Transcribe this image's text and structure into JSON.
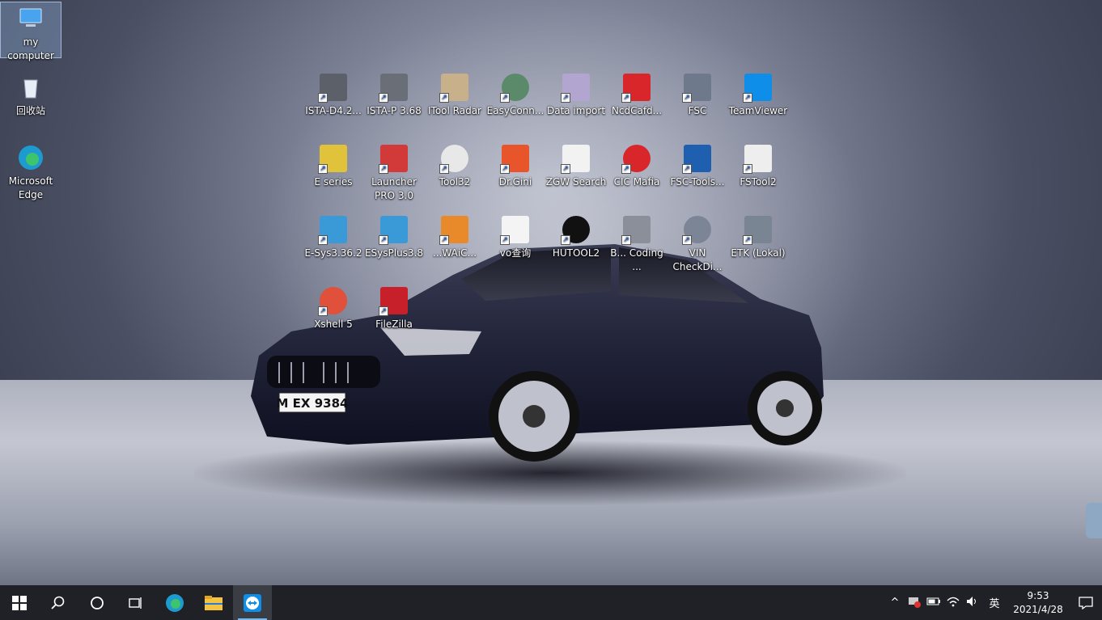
{
  "desktop_icons": [
    {
      "label": "my computer",
      "icon": "computer-icon"
    },
    {
      "label": "回收站",
      "icon": "recycle-bin-icon"
    },
    {
      "label": "Microsoft Edge",
      "icon": "edge-icon"
    }
  ],
  "shortcuts": [
    {
      "label": "ISTA-D4.2...",
      "icon": "ista-d-icon"
    },
    {
      "label": "ISTA-P 3.68",
      "icon": "ista-p-icon"
    },
    {
      "label": "ITool Radar",
      "icon": "itool-radar-icon"
    },
    {
      "label": "EasyConn...",
      "icon": "easyconnect-icon"
    },
    {
      "label": "Data import",
      "icon": "data-import-icon"
    },
    {
      "label": "NcdCafd...",
      "icon": "ncdcafd-icon"
    },
    {
      "label": "FSC",
      "icon": "fsc-icon"
    },
    {
      "label": "TeamViewer",
      "icon": "teamviewer-icon"
    },
    {
      "label": "E series",
      "icon": "e-series-icon"
    },
    {
      "label": "Launcher PRO 3.0",
      "icon": "launcher-pro-icon"
    },
    {
      "label": "Tool32",
      "icon": "tool32-icon"
    },
    {
      "label": "Dr.Gini",
      "icon": "drgini-icon"
    },
    {
      "label": "ZGW Search",
      "icon": "zgw-search-icon"
    },
    {
      "label": "CIC Mafia",
      "icon": "cic-mafia-icon"
    },
    {
      "label": "FSC-Tools...",
      "icon": "fsc-tools-icon"
    },
    {
      "label": "FSTool2",
      "icon": "fstool2-icon"
    },
    {
      "label": "E-Sys3.36.2",
      "icon": "esys-icon"
    },
    {
      "label": "ESysPlus3.8",
      "icon": "esysplus-icon"
    },
    {
      "label": "...WAiC...",
      "icon": "waic-icon"
    },
    {
      "label": "vo查询",
      "icon": "vo-query-icon"
    },
    {
      "label": "HUTOOL2",
      "icon": "hutool2-icon"
    },
    {
      "label": "B... Coding ...",
      "icon": "coding-icon"
    },
    {
      "label": "VIN CheckDi...",
      "icon": "vin-check-icon"
    },
    {
      "label": "ETK (Lokal)",
      "icon": "etk-icon"
    },
    {
      "label": "Xshell 5",
      "icon": "xshell-icon"
    },
    {
      "label": "FileZilla",
      "icon": "filezilla-icon"
    }
  ],
  "wallpaper": {
    "plate": "M EX 9384"
  },
  "taskbar": {
    "apps": [
      "start-icon",
      "search-icon",
      "cortana-icon",
      "task-view-icon",
      "edge-icon",
      "file-explorer-icon",
      "teamviewer-icon"
    ],
    "tray": {
      "chevron": "^",
      "ime": "英",
      "time": "9:53",
      "date": "2021/4/28"
    }
  },
  "colors": {
    "taskbar": "#1f2126",
    "accent": "#76b9ed"
  }
}
